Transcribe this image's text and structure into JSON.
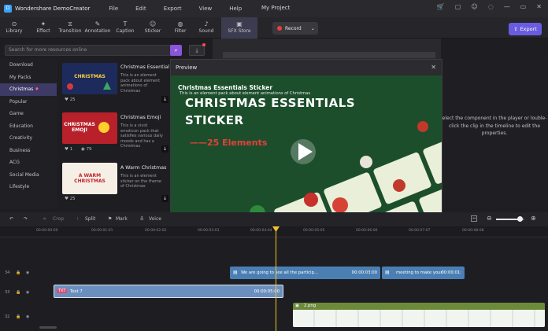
{
  "app": {
    "name": "Wondershare DemoCreator",
    "project": "My Project"
  },
  "menu": [
    "File",
    "Edit",
    "Export",
    "View",
    "Help"
  ],
  "toolbar": {
    "tabs": [
      {
        "label": "Library",
        "icon": "library-icon",
        "glyph": "⊙"
      },
      {
        "label": "Effect",
        "icon": "effect-icon",
        "glyph": "✦"
      },
      {
        "label": "Transition",
        "icon": "transition-icon",
        "glyph": "⧖"
      },
      {
        "label": "Annotation",
        "icon": "annotation-icon",
        "glyph": "✎"
      },
      {
        "label": "Caption",
        "icon": "caption-icon",
        "glyph": "T"
      },
      {
        "label": "Sticker",
        "icon": "sticker-icon",
        "glyph": "☺"
      },
      {
        "label": "Filter",
        "icon": "filter-icon",
        "glyph": "◍"
      },
      {
        "label": "Sound",
        "icon": "sound-icon",
        "glyph": "♪"
      },
      {
        "label": "SFX Store",
        "icon": "store-icon",
        "glyph": "▣"
      }
    ],
    "record_label": "Record",
    "export_label": "Export"
  },
  "search": {
    "placeholder": "Search for more resources online"
  },
  "categories": [
    "Download",
    "My Packs",
    "Christmas",
    "Popular",
    "Game",
    "Education",
    "Creativity",
    "Business",
    "ACG",
    "Social Media",
    "Lifestyle"
  ],
  "items": [
    {
      "title": "Christmas Essentials St...",
      "desc": "This is an element pack about element animations of Christmas",
      "likes": "25",
      "comments": "",
      "thumb_text": "CHRISTMAS"
    },
    {
      "title": "Christmas Emoji",
      "desc": "This is a vivid emoticon pack that satisfies various daily moods and has a Christmas",
      "likes": "1",
      "comments": "79",
      "thumb_text": "CHRISTMAS EMOJI"
    },
    {
      "title": "A Warm Christmas",
      "desc": "This is an element sticker on the theme of Christmas",
      "likes": "25",
      "comments": "",
      "thumb_text": "A WARM CHRISTMAS"
    }
  ],
  "properties": {
    "hint": "elect the component in the player or louble-click the clip in the timeline to edit the properties."
  },
  "preview": {
    "title": "Preview",
    "video_title": "Christmas Essentials Sticker",
    "video_subtitle": "This is an element pack about element animations of Christmas",
    "big_line1": "CHRISTMAS ESSENTIALS",
    "big_line2": "STICKER",
    "elements_text": "——25 Elements"
  },
  "editbar": {
    "crop": "Crop",
    "split": "Split",
    "mark": "Mark",
    "voice": "Voice",
    "zoom_level": 0.85
  },
  "timeline": {
    "ticks": [
      "00:00:00:00",
      "00:00:01:01",
      "00:00:02:02",
      "00:00:03:03",
      "00:00:04:04",
      "00:00:05:05",
      "00:00:06:06",
      "00:00:07:07",
      "00:00:08:08"
    ],
    "tracks": [
      "34",
      "33",
      "32"
    ],
    "clips": [
      {
        "label": "We are going to see all the particip...",
        "time": "00:00:03:00"
      },
      {
        "label": "meeting to make your",
        "time": "00:00:01:"
      },
      {
        "label": "Text 7",
        "time": "00:00:05:00"
      },
      {
        "label": "2.png",
        "time": ""
      }
    ]
  },
  "colors": {
    "accent": "#6a5ce0",
    "search_button": "#8b55d9",
    "playhead": "#f2c230",
    "clip_blue": "#4b7fb4",
    "clip_green": "#6b8a3a"
  }
}
